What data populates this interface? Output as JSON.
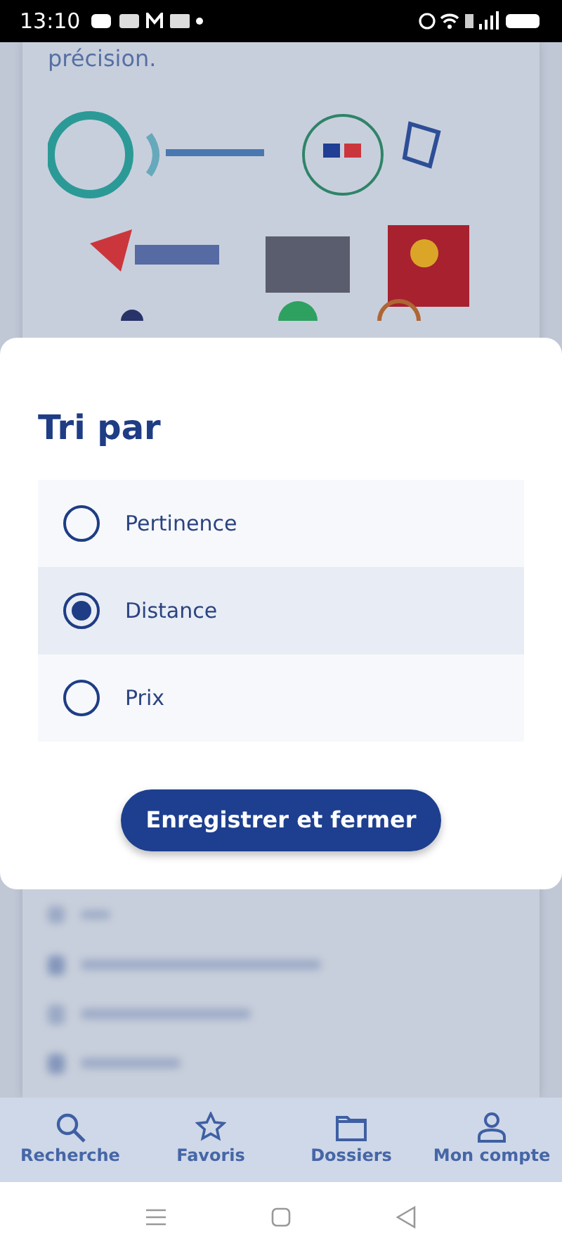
{
  "status_bar": {
    "time": "13:10"
  },
  "background": {
    "text": "précision."
  },
  "sheet": {
    "title": "Tri par",
    "options": [
      {
        "label": "Pertinence",
        "selected": false
      },
      {
        "label": "Distance",
        "selected": true
      },
      {
        "label": "Prix",
        "selected": false
      }
    ],
    "button": "Enregistrer et fermer"
  },
  "bottom_nav": [
    {
      "label": "Recherche"
    },
    {
      "label": "Favoris"
    },
    {
      "label": "Dossiers"
    },
    {
      "label": "Mon compte"
    }
  ]
}
